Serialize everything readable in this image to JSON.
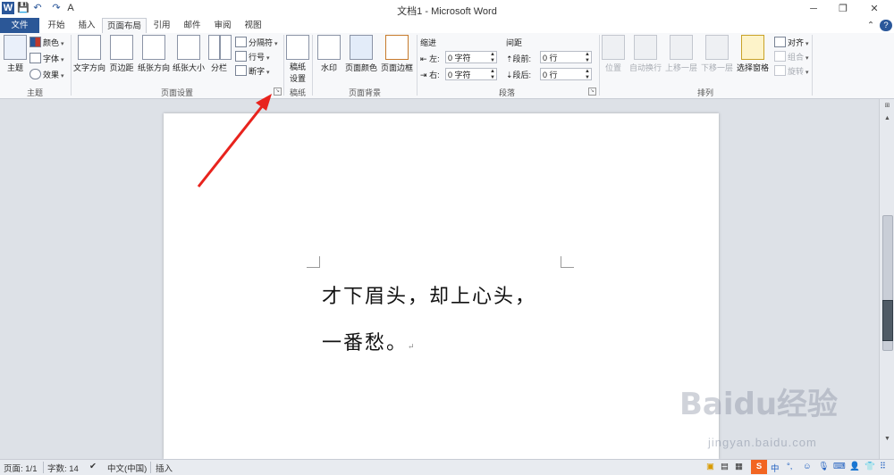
{
  "window": {
    "title": "文档1 - Microsoft Word",
    "controls": {
      "minimize": "─",
      "restore": "❐",
      "close": "✕"
    }
  },
  "qat": [
    "W",
    "💾",
    "↶",
    "↷",
    "A"
  ],
  "tabs": [
    {
      "label": "文件",
      "state": "file"
    },
    {
      "label": "开始",
      "state": "normal"
    },
    {
      "label": "插入",
      "state": "normal"
    },
    {
      "label": "页面布局",
      "state": "active"
    },
    {
      "label": "引用",
      "state": "normal"
    },
    {
      "label": "邮件",
      "state": "normal"
    },
    {
      "label": "审阅",
      "state": "normal"
    },
    {
      "label": "视图",
      "state": "normal"
    }
  ],
  "ribbon": {
    "theme": {
      "themes_label": "主题",
      "colors": "颜色",
      "fonts": "字体",
      "effects": "效果",
      "group_label": "主题"
    },
    "page_setup": {
      "text_direction": "文字方向",
      "margins": "页边距",
      "orientation": "纸张方向",
      "size": "纸张大小",
      "columns": "分栏",
      "breaks": "分隔符",
      "line_numbers": "行号",
      "hyphenation": "断字",
      "group_label": "页面设置"
    },
    "draft": {
      "draft_settings_line1": "稿纸",
      "draft_settings_line2": "设置",
      "group_label": "稿纸"
    },
    "page_background": {
      "watermark": "水印",
      "page_color": "页面颜色",
      "page_borders": "页面边框",
      "group_label": "页面背景"
    },
    "paragraph": {
      "indent_heading": "缩进",
      "spacing_heading": "间距",
      "left_label": "左:",
      "right_label": "右:",
      "before_label": "段前:",
      "after_label": "段后:",
      "left_value": "0 字符",
      "right_value": "0 字符",
      "before_value": "0 行",
      "after_value": "0 行",
      "group_label": "段落"
    },
    "arrange": {
      "position": "位置",
      "wrap_text": "自动换行",
      "bring_forward": "上移一层",
      "send_backward": "下移一层",
      "selection_pane": "选择窗格",
      "align": "对齐",
      "group": "组合",
      "rotate": "旋转",
      "group_label": "排列"
    }
  },
  "document": {
    "line1": "才下眉头，却上心头，",
    "line2": "一番愁。",
    "para_mark": "↵"
  },
  "statusbar": {
    "page": "页面: 1/1",
    "words": "字数: 14",
    "language": "中文(中国)",
    "mode": "插入",
    "ime": [
      "S",
      "中",
      "°,",
      "☺",
      "🎙",
      "⌨",
      "👤",
      "👕",
      "⠿"
    ]
  },
  "watermark": {
    "main": "Baidu经验",
    "sub": "jingyan.baidu.com"
  },
  "colors": {
    "file_tab": "#2b5797",
    "annotation_arrow": "#e8231d",
    "ime_orange": "#f26522"
  }
}
